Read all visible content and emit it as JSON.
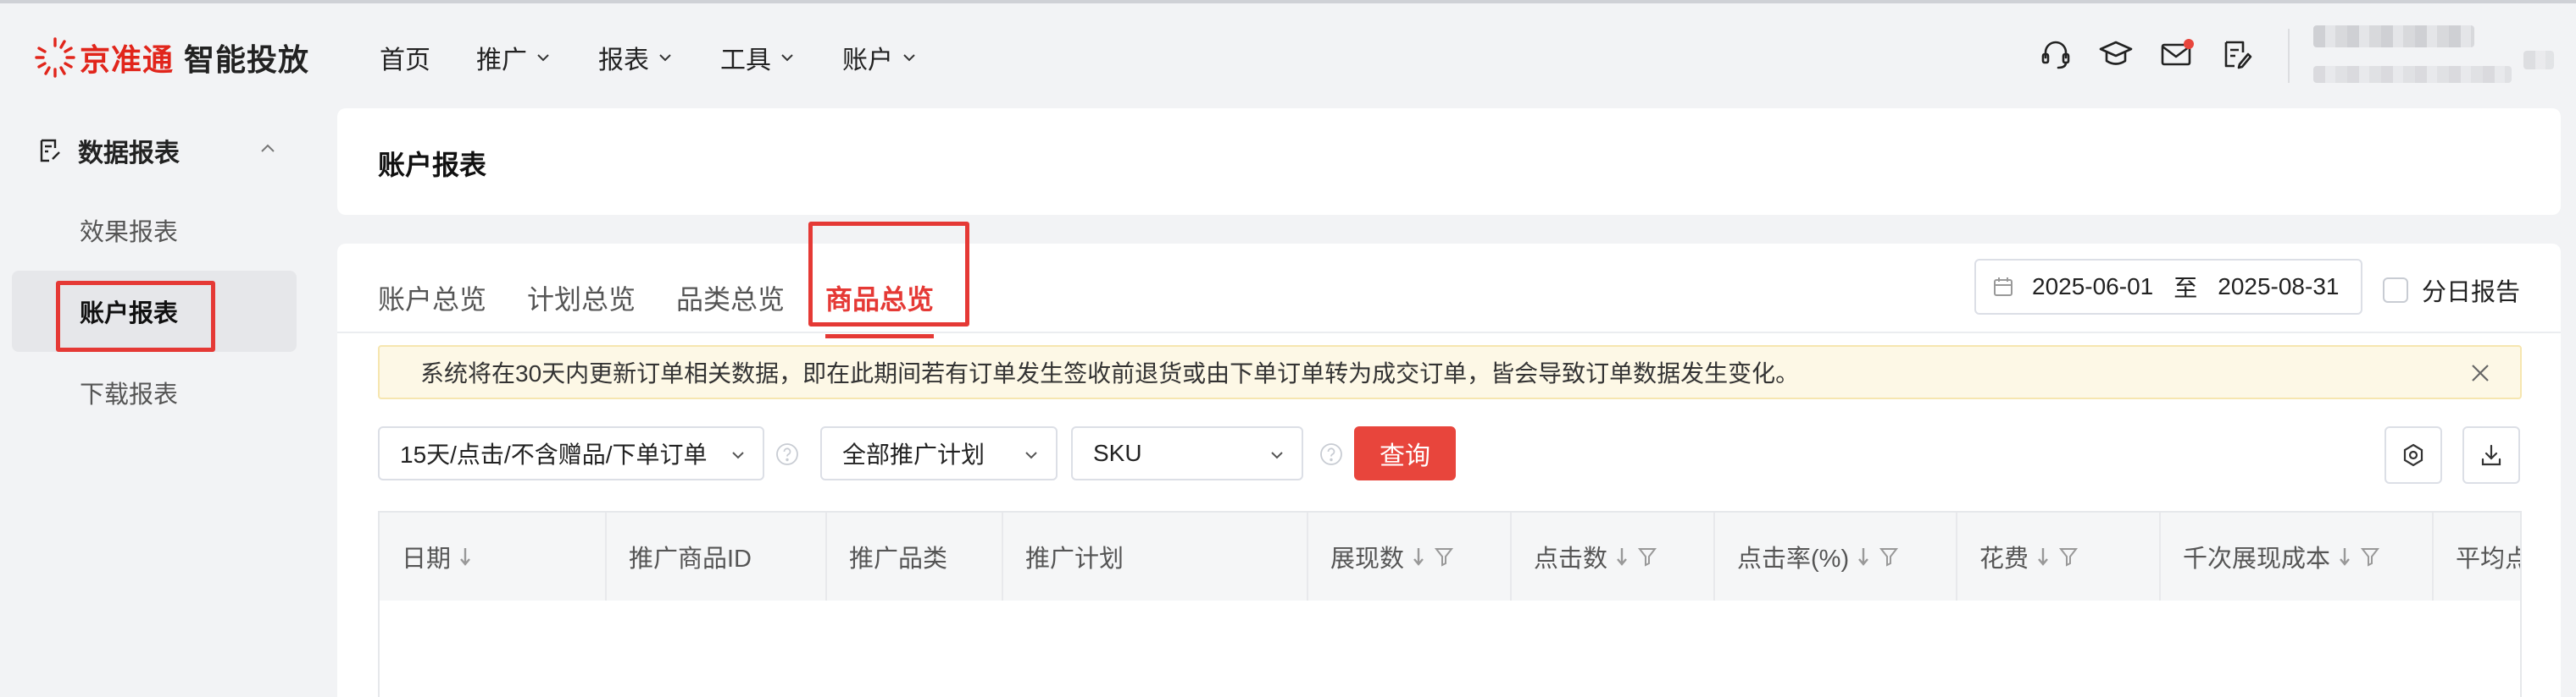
{
  "header": {
    "brand_name": "京准通",
    "brand_sub": "智能投放",
    "nav": [
      {
        "label": "首页",
        "has_dropdown": false
      },
      {
        "label": "推广",
        "has_dropdown": true
      },
      {
        "label": "报表",
        "has_dropdown": true
      },
      {
        "label": "工具",
        "has_dropdown": true
      },
      {
        "label": "账户",
        "has_dropdown": true
      }
    ],
    "icons": [
      "headset-icon",
      "graduation-cap-icon",
      "mail-icon",
      "task-list-icon"
    ],
    "mail_has_unread": true
  },
  "sidebar": {
    "section_title": "数据报表",
    "items": [
      {
        "label": "效果报表",
        "active": false
      },
      {
        "label": "账户报表",
        "active": true
      },
      {
        "label": "下载报表",
        "active": false
      }
    ]
  },
  "page": {
    "title": "账户报表"
  },
  "tabs": [
    {
      "label": "账户总览",
      "active": false
    },
    {
      "label": "计划总览",
      "active": false
    },
    {
      "label": "品类总览",
      "active": false
    },
    {
      "label": "商品总览",
      "active": true
    }
  ],
  "date_range": {
    "start": "2025-06-01",
    "separator": "至",
    "end": "2025-08-31"
  },
  "split_by_day": {
    "label": "分日报告",
    "checked": false
  },
  "notice": {
    "text": "系统将在30天内更新订单相关数据，即在此期间若有订单发生签收前退货或由下单订单转为成交订单，皆会导致订单数据发生变化。"
  },
  "filters": {
    "attribution": "15天/点击/不含赠品/下单订单",
    "campaign": "全部推广计划",
    "dimension": "SKU",
    "query_label": "查询"
  },
  "table": {
    "columns": [
      {
        "label": "日期",
        "sortable": true,
        "filterable": false
      },
      {
        "label": "推广商品ID",
        "sortable": false,
        "filterable": false
      },
      {
        "label": "推广品类",
        "sortable": false,
        "filterable": false
      },
      {
        "label": "推广计划",
        "sortable": false,
        "filterable": false
      },
      {
        "label": "展现数",
        "sortable": true,
        "filterable": true
      },
      {
        "label": "点击数",
        "sortable": true,
        "filterable": true
      },
      {
        "label": "点击率(%)",
        "sortable": true,
        "filterable": true
      },
      {
        "label": "花费",
        "sortable": true,
        "filterable": true
      },
      {
        "label": "千次展现成本",
        "sortable": true,
        "filterable": true
      },
      {
        "label": "平均点",
        "sortable": false,
        "filterable": false
      }
    ],
    "rows": []
  },
  "colors": {
    "brand_red": "#e1251b",
    "accent_red": "#e53935",
    "query_button": "#e8453c",
    "notice_bg": "#fdf8e6"
  }
}
